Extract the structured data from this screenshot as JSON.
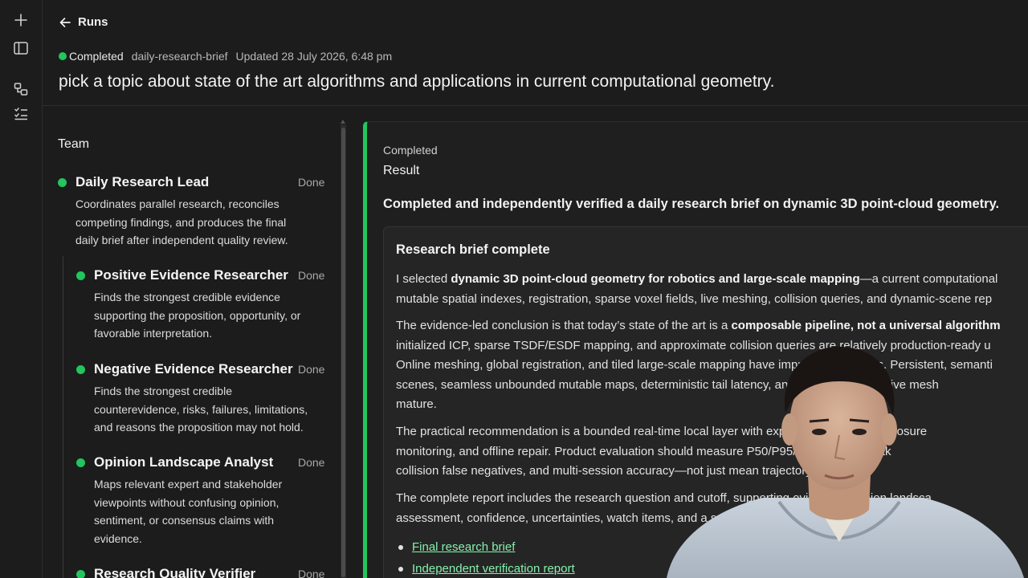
{
  "header": {
    "back_label": "Runs",
    "status": "Completed",
    "slug": "daily-research-brief",
    "updated": "Updated 28 July 2026, 6:48 pm",
    "title": "pick a topic about state of the art algorithms and applications in current computational geometry."
  },
  "team": {
    "title": "Team",
    "members": [
      {
        "name": "Daily Research Lead",
        "state": "Done",
        "desc": [
          "Coordinates parallel research, reconciles",
          "competing findings, and produces the final",
          "daily brief after independent quality review."
        ]
      },
      {
        "name": "Positive Evidence Researcher",
        "state": "Done",
        "desc": [
          "Finds the strongest credible evidence",
          "supporting the proposition, opportunity, or",
          "favorable interpretation."
        ]
      },
      {
        "name": "Negative Evidence Researcher",
        "state": "Done",
        "desc": [
          "Finds the strongest credible",
          "counterevidence, risks, failures, limitations,",
          "and reasons the proposition may not hold."
        ]
      },
      {
        "name": "Opinion Landscape Analyst",
        "state": "Done",
        "desc": [
          "Maps relevant expert and stakeholder",
          "viewpoints without confusing opinion,",
          "sentiment, or consensus claims with",
          "evidence."
        ]
      },
      {
        "name": "Research Quality Verifier",
        "state": "Done",
        "desc": []
      }
    ]
  },
  "result": {
    "status": "Completed",
    "title": "Result",
    "summary": "Completed and independently verified a daily research brief on dynamic 3D point-cloud geometry.",
    "card_title": "Research brief complete",
    "p1": {
      "a": "I selected ",
      "b": "dynamic 3D point-cloud geometry for robotics and large-scale mapping",
      "c": "—a current computational",
      "l2": "mutable spatial indexes, registration, sparse voxel fields, live meshing, collision queries, and dynamic-scene rep"
    },
    "p2": {
      "a": "The evidence-led conclusion is that today’s state of the art is a ",
      "b": "composable pipeline, not a universal algorithm",
      "l2": "initialized ICP, sparse TSDF/ESDF mapping, and approximate collision queries are relatively production-ready u",
      "l3": "Online meshing, global registration, and tiled large-scale mapping have improved readiness. Persistent, semanti",
      "l4": "scenes, seamless unbounded mutable maps, deterministic tail latency, and topology-correct live mesh",
      "l5": "mature."
    },
    "p3": {
      "l1": "The practical recommendation is a bounded real-time local layer with explicit submaps, loop closure",
      "l2": "monitoring, and offline repair. Product evaluation should measure P50/P95/P99 latency, peak",
      "l3": "collision false negatives, and multi-session accuracy—not just mean trajectory error."
    },
    "p4": {
      "l1": "The complete report includes the research question and cutoff, supporting evidence, opinion landsca",
      "l2": "assessment, confidence, uncertainties, watch items, and a source ledger:"
    },
    "links": [
      "Final research brief",
      "Independent verification report"
    ]
  },
  "colors": {
    "accent": "#22c55e",
    "link": "#86efac",
    "bg": "#1c1c1c"
  }
}
